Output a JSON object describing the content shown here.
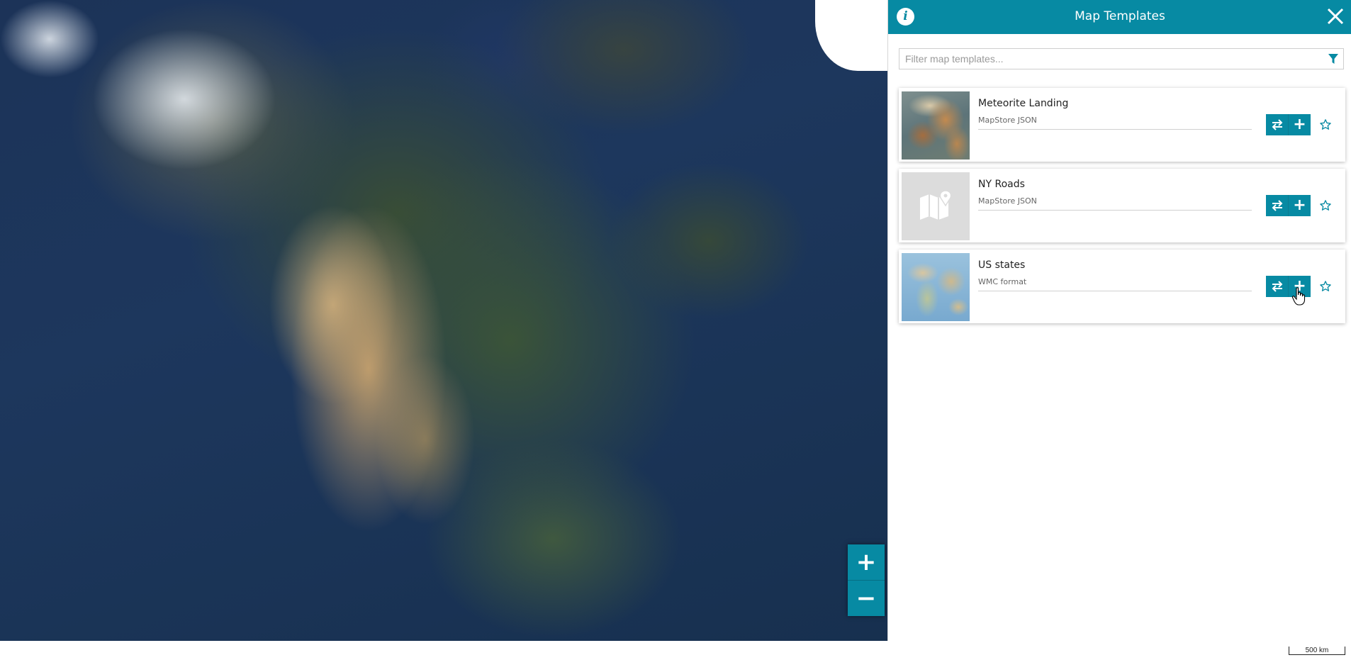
{
  "panel": {
    "title": "Map Templates",
    "filter_placeholder": "Filter map templates...",
    "accent_color": "#078aa3"
  },
  "templates": [
    {
      "title": "Meteorite Landing",
      "format": "MapStore JSON",
      "thumbnail": "meteorite-map-thumbnail"
    },
    {
      "title": "NY Roads",
      "format": "MapStore JSON",
      "thumbnail": "default-map-icon"
    },
    {
      "title": "US states",
      "format": "WMC format",
      "thumbnail": "world-map-thumbnail"
    }
  ],
  "map": {
    "zoom_in_label": "+",
    "zoom_out_label": "−",
    "scale_label": "500 km"
  },
  "icons": {
    "info": "info-icon",
    "close": "close-icon",
    "filter": "funnel-icon",
    "replace": "swap-arrows-icon",
    "add": "plus-icon",
    "favorite": "star-outline-icon"
  }
}
